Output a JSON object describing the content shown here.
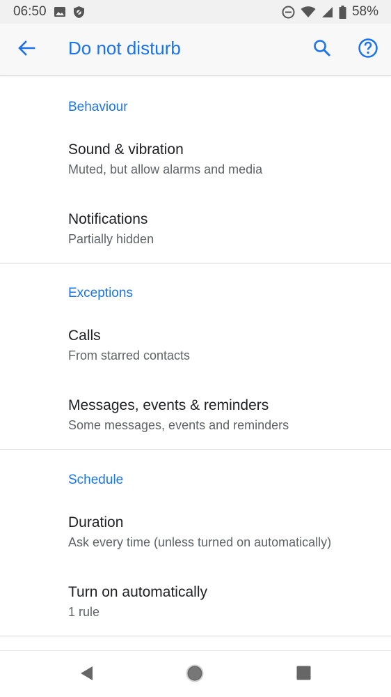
{
  "status_bar": {
    "time": "06:50",
    "battery": "58%",
    "icons": [
      "image-icon",
      "shield-icon",
      "dnd-icon",
      "wifi-icon",
      "signal-icon",
      "battery-icon"
    ]
  },
  "app_bar": {
    "title": "Do not disturb",
    "accent_color": "#1a73e8",
    "icons": [
      "back-arrow-icon",
      "search-icon",
      "help-icon"
    ]
  },
  "sections": [
    {
      "header": "Behaviour",
      "items": [
        {
          "title": "Sound & vibration",
          "subtitle": "Muted, but allow alarms and media"
        },
        {
          "title": "Notifications",
          "subtitle": "Partially hidden"
        }
      ]
    },
    {
      "header": "Exceptions",
      "items": [
        {
          "title": "Calls",
          "subtitle": "From starred contacts"
        },
        {
          "title": "Messages, events & reminders",
          "subtitle": "Some messages, events and reminders"
        }
      ]
    },
    {
      "header": "Schedule",
      "items": [
        {
          "title": "Duration",
          "subtitle": "Ask every time (unless turned on automatically)"
        },
        {
          "title": "Turn on automatically",
          "subtitle": "1 rule"
        }
      ]
    }
  ],
  "nav_bar": {
    "icons": [
      "back-triangle-icon",
      "home-circle-icon",
      "recents-square-icon"
    ]
  }
}
